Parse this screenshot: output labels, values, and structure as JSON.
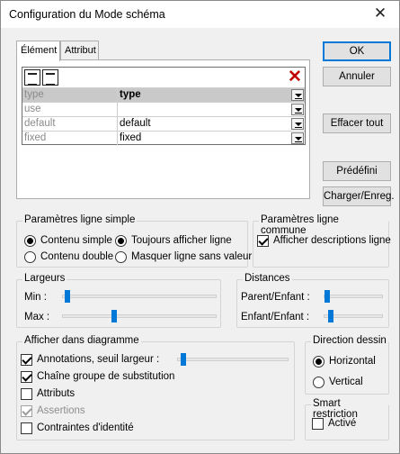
{
  "window": {
    "title": "Configuration du Mode schéma"
  },
  "tabs": [
    "Élément",
    "Attribut"
  ],
  "grid": {
    "rows": [
      {
        "name": "type",
        "value": "type",
        "selected": true
      },
      {
        "name": "use",
        "value": "",
        "selected": false
      },
      {
        "name": "default",
        "value": "default",
        "selected": false
      },
      {
        "name": "fixed",
        "value": "fixed",
        "selected": false
      }
    ]
  },
  "buttons": {
    "ok": "OK",
    "annuler": "Annuler",
    "effacer": "Effacer tout",
    "predefini": "Prédéfini",
    "charger": "Charger/Enreg."
  },
  "simple": {
    "label": "Paramètres ligne simple",
    "contenu_simple": "Contenu simple",
    "contenu_double": "Contenu double",
    "toujours": "Toujours afficher ligne",
    "masquer": "Masquer ligne sans valeur"
  },
  "commune": {
    "label": "Paramètres ligne commune",
    "afficher_desc": "Afficher descriptions ligne"
  },
  "largeurs": {
    "label": "Largeurs",
    "min": "Min :",
    "max": "Max :",
    "min_level": 0.02,
    "max_level": 0.33
  },
  "distances": {
    "label": "Distances",
    "parent_enfant": "Parent/Enfant :",
    "enfant_enfant": "Enfant/Enfant :",
    "parent_level": 0.02,
    "enfant_level": 0.08
  },
  "diagramme": {
    "label": "Afficher dans diagramme",
    "annotations": "Annotations, seuil largeur :",
    "chaine": "Chaîne groupe de substitution",
    "attributs": "Attributs",
    "assertions": "Assertions",
    "contraintes": "Contraintes d'identité",
    "seuil_level": 0.03
  },
  "direction": {
    "label": "Direction dessin",
    "horizontal": "Horizontal",
    "vertical": "Vertical"
  },
  "smart": {
    "label": "Smart restriction",
    "active": "Activé"
  },
  "colors": {
    "accent": "#0078d7",
    "selected_row": "#c9c9c9",
    "delete": "#c00000"
  }
}
